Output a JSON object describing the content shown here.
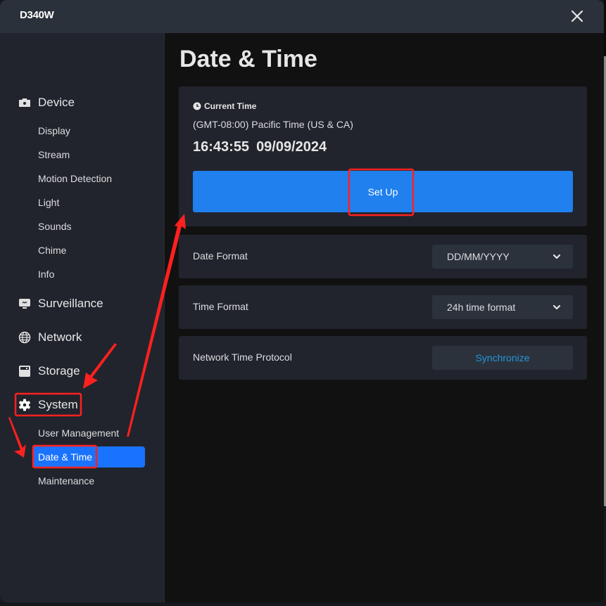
{
  "window": {
    "title": "D340W",
    "close_icon": "close-icon"
  },
  "sidebar": {
    "groups": [
      {
        "label": "Device",
        "icon": "camera-icon",
        "items": [
          "Display",
          "Stream",
          "Motion Detection",
          "Light",
          "Sounds",
          "Chime",
          "Info"
        ]
      },
      {
        "label": "Surveillance",
        "icon": "monitor-icon",
        "items": []
      },
      {
        "label": "Network",
        "icon": "globe-icon",
        "items": []
      },
      {
        "label": "Storage",
        "icon": "storage-icon",
        "items": []
      },
      {
        "label": "System",
        "icon": "gear-icon",
        "items": [
          "User Management",
          "Date & Time",
          "Maintenance"
        ]
      }
    ],
    "active_item": "Date & Time"
  },
  "main": {
    "page_title": "Date & Time",
    "current_time": {
      "heading": "Current Time",
      "icon": "clock-icon",
      "timezone": "(GMT-08:00) Pacific Time (US & CA)",
      "time": "16:43:55",
      "date": "09/09/2024",
      "setup_label": "Set Up"
    },
    "settings": [
      {
        "label": "Date Format",
        "type": "select",
        "value": "DD/MM/YYYY"
      },
      {
        "label": "Time Format",
        "type": "select",
        "value": "24h time format"
      },
      {
        "label": "Network Time Protocol",
        "type": "button",
        "value": "Synchronize"
      }
    ]
  },
  "colors": {
    "accent": "#1a73ff",
    "button_primary": "#1f80ee",
    "link": "#2395db",
    "annotation": "#ff2020"
  }
}
